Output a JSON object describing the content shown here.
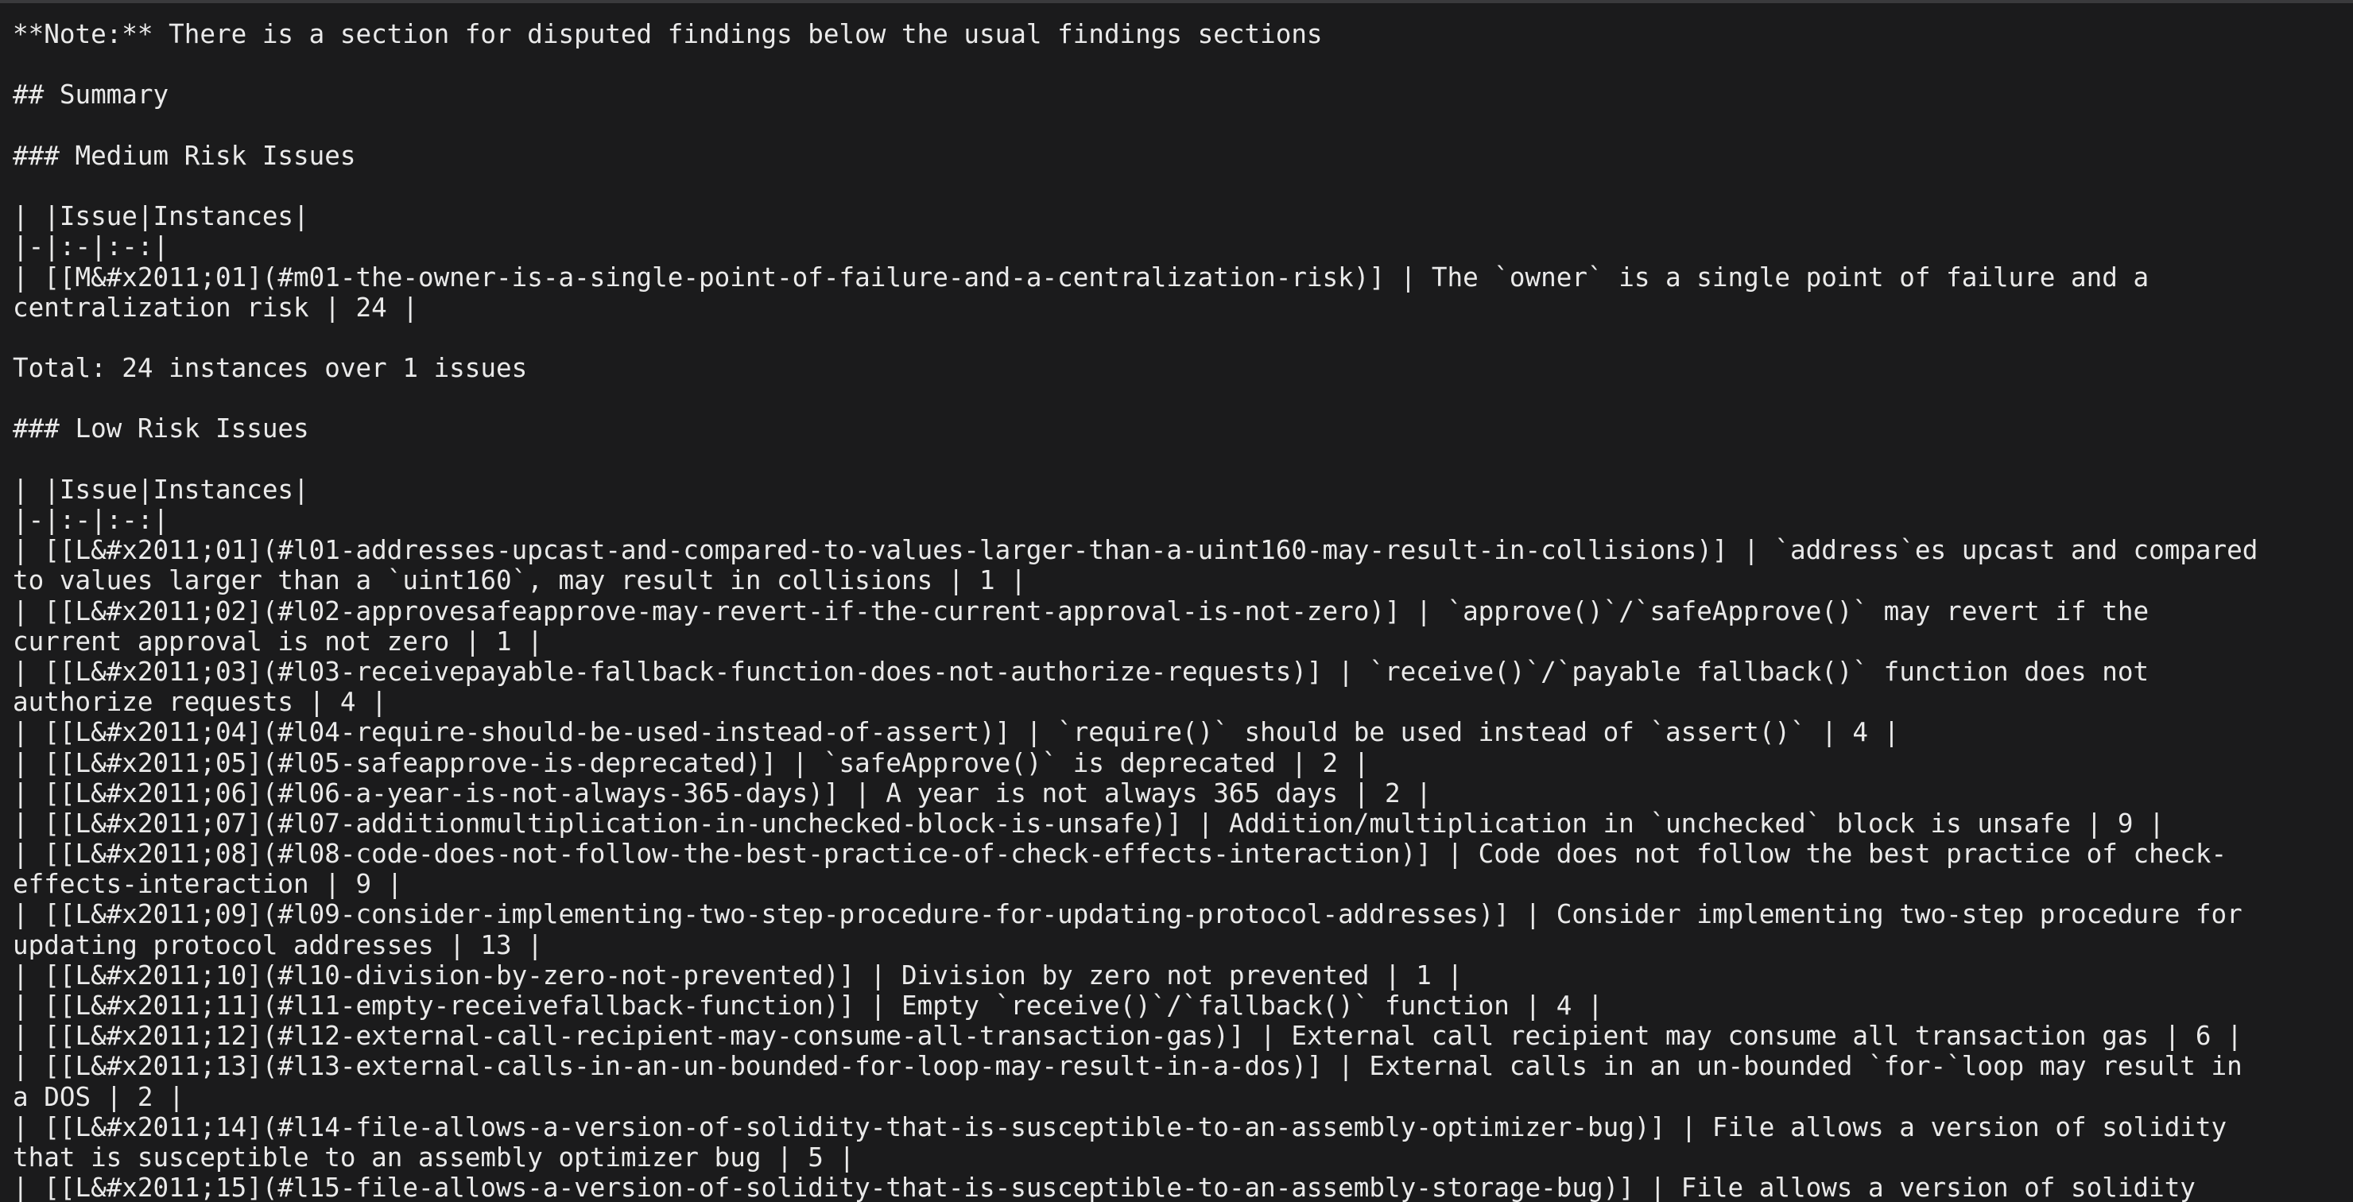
{
  "document": {
    "lines": [
      "**Note:** There is a section for disputed findings below the usual findings sections",
      "",
      "## Summary",
      "",
      "### Medium Risk Issues",
      "",
      "| |Issue|Instances|",
      "|-|:-|:-:|",
      "| [[M&#x2011;01](#m01-the-owner-is-a-single-point-of-failure-and-a-centralization-risk)] | The `owner` is a single point of failure and a",
      "centralization risk | 24 |",
      "",
      "Total: 24 instances over 1 issues",
      "",
      "### Low Risk Issues",
      "",
      "| |Issue|Instances|",
      "|-|:-|:-:|",
      "| [[L&#x2011;01](#l01-addresses-upcast-and-compared-to-values-larger-than-a-uint160-may-result-in-collisions)] | `address`es upcast and compared",
      "to values larger than a `uint160`, may result in collisions | 1 |",
      "| [[L&#x2011;02](#l02-approvesafeapprove-may-revert-if-the-current-approval-is-not-zero)] | `approve()`/`safeApprove()` may revert if the",
      "current approval is not zero | 1 |",
      "| [[L&#x2011;03](#l03-receivepayable-fallback-function-does-not-authorize-requests)] | `receive()`/`payable fallback()` function does not",
      "authorize requests | 4 |",
      "| [[L&#x2011;04](#l04-require-should-be-used-instead-of-assert)] | `require()` should be used instead of `assert()` | 4 |",
      "| [[L&#x2011;05](#l05-safeapprove-is-deprecated)] | `safeApprove()` is deprecated | 2 |",
      "| [[L&#x2011;06](#l06-a-year-is-not-always-365-days)] | A year is not always 365 days | 2 |",
      "| [[L&#x2011;07](#l07-additionmultiplication-in-unchecked-block-is-unsafe)] | Addition/multiplication in `unchecked` block is unsafe | 9 |",
      "| [[L&#x2011;08](#l08-code-does-not-follow-the-best-practice-of-check-effects-interaction)] | Code does not follow the best practice of check-",
      "effects-interaction | 9 |",
      "| [[L&#x2011;09](#l09-consider-implementing-two-step-procedure-for-updating-protocol-addresses)] | Consider implementing two-step procedure for",
      "updating protocol addresses | 13 |",
      "| [[L&#x2011;10](#l10-division-by-zero-not-prevented)] | Division by zero not prevented | 1 |",
      "| [[L&#x2011;11](#l11-empty-receivefallback-function)] | Empty `receive()`/`fallback()` function | 4 |",
      "| [[L&#x2011;12](#l12-external-call-recipient-may-consume-all-transaction-gas)] | External call recipient may consume all transaction gas | 6 |",
      "| [[L&#x2011;13](#l13-external-calls-in-an-un-bounded-for-loop-may-result-in-a-dos)] | External calls in an un-bounded `for-`loop may result in",
      "a DOS | 2 |",
      "| [[L&#x2011;14](#l14-file-allows-a-version-of-solidity-that-is-susceptible-to-an-assembly-optimizer-bug)] | File allows a version of solidity",
      "that is susceptible to an assembly optimizer bug | 5 |",
      "| [[L&#x2011;15](#l15-file-allows-a-version-of-solidity-that-is-susceptible-to-an-assembly-storage-bug)] | File allows a version of solidity"
    ]
  }
}
